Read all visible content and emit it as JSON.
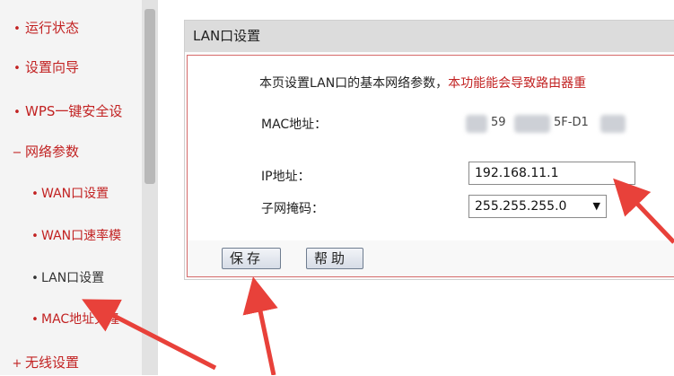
{
  "sidebar": {
    "items": [
      {
        "bullet": "•",
        "label": "运行状态"
      },
      {
        "bullet": "•",
        "label": "设置向导"
      },
      {
        "bullet": "•",
        "label": "WPS一键安全设"
      },
      {
        "bullet": "−",
        "label": "网络参数"
      },
      {
        "bullet": "•",
        "label": "WAN口设置"
      },
      {
        "bullet": "•",
        "label": "WAN口速率模"
      },
      {
        "bullet": "•",
        "label": "LAN口设置"
      },
      {
        "bullet": "•",
        "label": "MAC地址克隆"
      },
      {
        "bullet": "+",
        "label": "无线设置"
      }
    ]
  },
  "panel": {
    "title": "LAN口设置",
    "intro": "本页设置LAN口的基本网络参数，",
    "warning": "本功能能会导致路由器重",
    "mac_label": "MAC地址：",
    "mac_part1": "59",
    "mac_part2": "5F-D1",
    "ip_label": "IP地址：",
    "ip_value": "192.168.11.1",
    "mask_label": "子网掩码：",
    "mask_value": "255.255.255.0",
    "save_label": "保存",
    "help_label": "帮助"
  },
  "colors": {
    "menu_red": "#c22222",
    "annotation_red": "#e8413a"
  }
}
